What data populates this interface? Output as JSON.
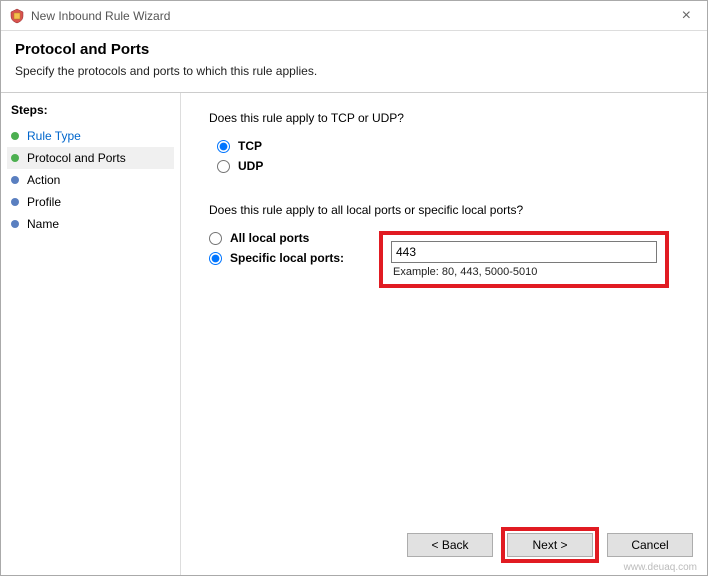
{
  "window": {
    "title": "New Inbound Rule Wizard"
  },
  "header": {
    "title": "Protocol and Ports",
    "subtitle": "Specify the protocols and ports to which this rule applies."
  },
  "steps": {
    "label": "Steps:",
    "items": [
      {
        "label": "Rule Type"
      },
      {
        "label": "Protocol and Ports"
      },
      {
        "label": "Action"
      },
      {
        "label": "Profile"
      },
      {
        "label": "Name"
      }
    ]
  },
  "content": {
    "question1": "Does this rule apply to TCP or UDP?",
    "protocol": {
      "tcp": "TCP",
      "udp": "UDP"
    },
    "question2": "Does this rule apply to all local ports or specific local ports?",
    "ports": {
      "all": "All local ports",
      "specific": "Specific local ports:",
      "value": "443",
      "example": "Example: 80, 443, 5000-5010"
    }
  },
  "buttons": {
    "back": "< Back",
    "next": "Next >",
    "cancel": "Cancel"
  },
  "watermark": "www.deuaq.com"
}
